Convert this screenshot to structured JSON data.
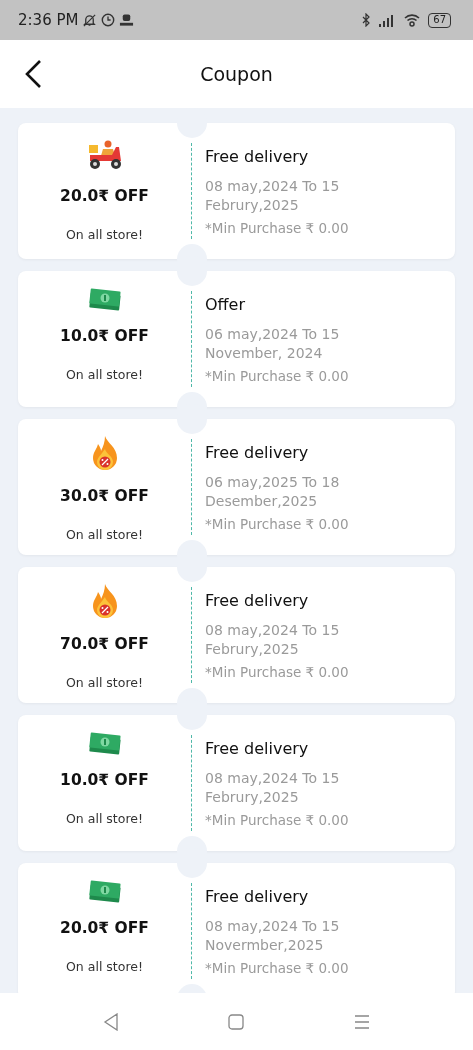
{
  "status_bar": {
    "time": "2:36 PM",
    "battery": "67"
  },
  "header": {
    "title": "Coupon"
  },
  "coupons": [
    {
      "kind": "scooter",
      "amount": "20.0₹ OFF",
      "scope": "On all store!",
      "title": "Free delivery",
      "dates": "08 may,2024 To 15 Februry,2025",
      "min_purchase": "*Min Purchase ₹ 0.00"
    },
    {
      "kind": "cash",
      "amount": "10.0₹ OFF",
      "scope": "On all store!",
      "title": "Offer",
      "dates": "06 may,2024 To 15 November, 2024",
      "min_purchase": "*Min Purchase ₹ 0.00"
    },
    {
      "kind": "fire",
      "amount": "30.0₹ OFF",
      "scope": "On all store!",
      "title": "Free delivery",
      "dates": "06 may,2025 To 18 Desember,2025",
      "min_purchase": "*Min Purchase ₹ 0.00"
    },
    {
      "kind": "fire",
      "amount": "70.0₹ OFF",
      "scope": "On all store!",
      "title": "Free delivery",
      "dates": "08 may,2024 To 15 Februry,2025",
      "min_purchase": "*Min Purchase ₹ 0.00"
    },
    {
      "kind": "cash",
      "amount": "10.0₹ OFF",
      "scope": "On all store!",
      "title": "Free delivery",
      "dates": "08 may,2024 To 15 Februry,2025",
      "min_purchase": "*Min Purchase ₹ 0.00"
    },
    {
      "kind": "cash",
      "amount": "20.0₹ OFF",
      "scope": "On all store!",
      "title": "Free delivery",
      "dates": "08 may,2024 To 15 Novermber,2025",
      "min_purchase": "*Min Purchase ₹ 0.00"
    }
  ]
}
